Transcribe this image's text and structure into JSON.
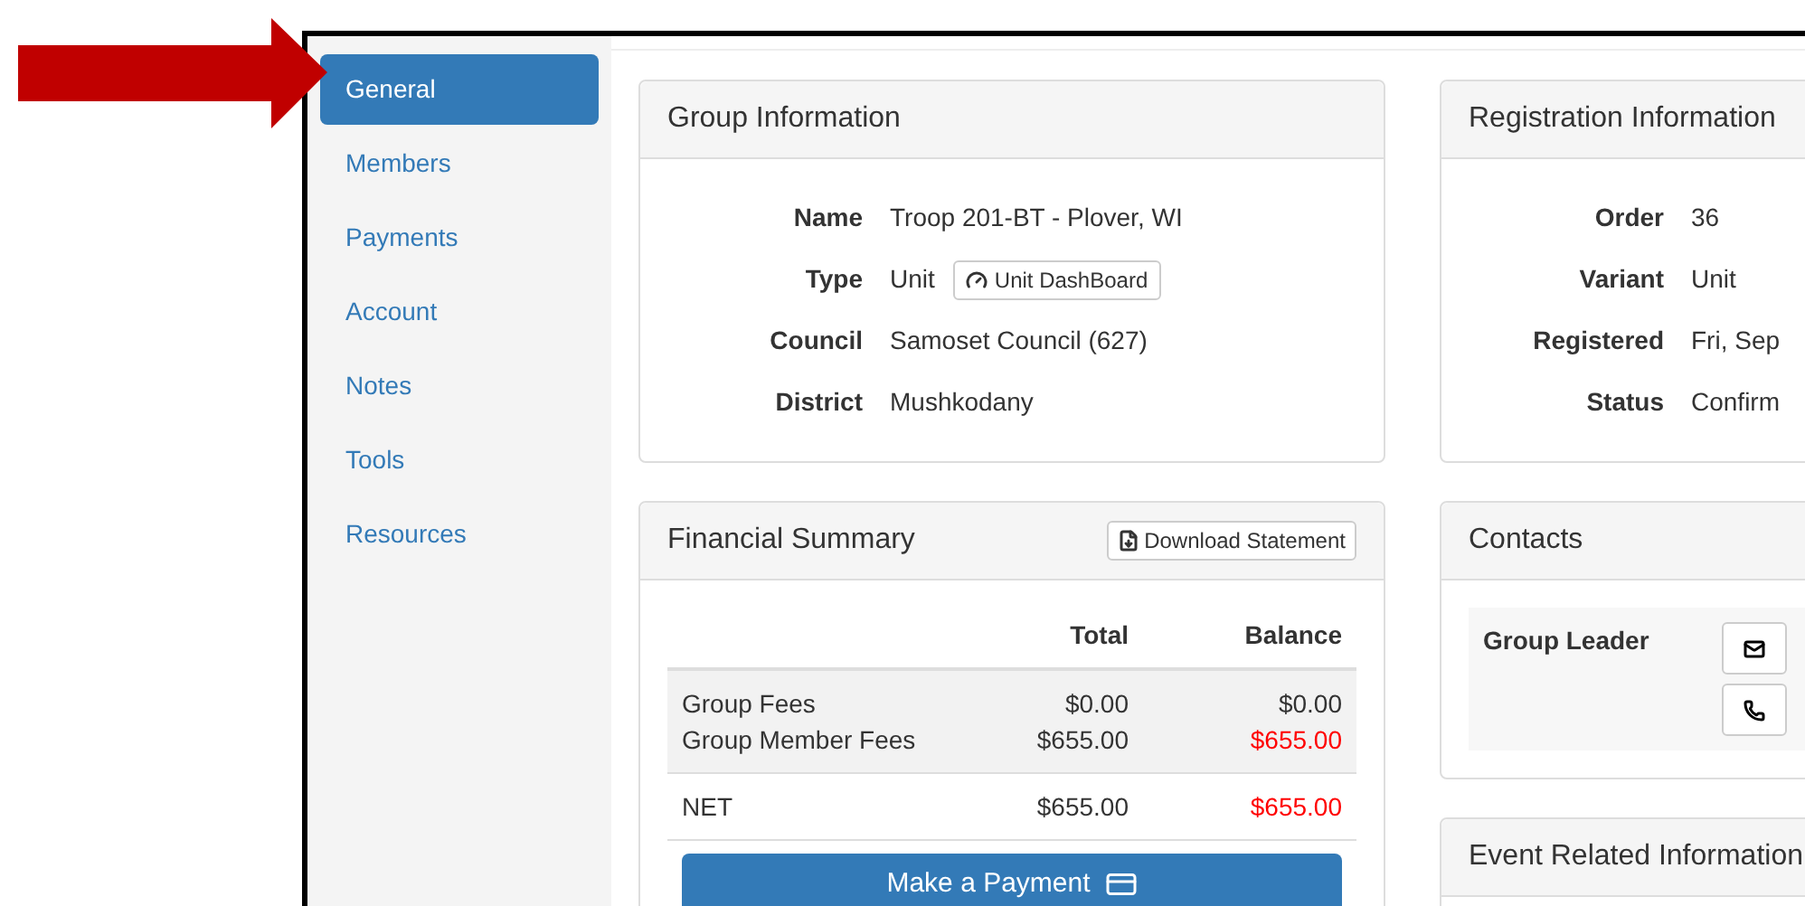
{
  "sidebar": {
    "items": [
      {
        "label": "General",
        "selected": true
      },
      {
        "label": "Members",
        "selected": false
      },
      {
        "label": "Payments",
        "selected": false
      },
      {
        "label": "Account",
        "selected": false
      },
      {
        "label": "Notes",
        "selected": false
      },
      {
        "label": "Tools",
        "selected": false
      },
      {
        "label": "Resources",
        "selected": false
      }
    ]
  },
  "group_information": {
    "title": "Group Information",
    "fields": [
      {
        "label": "Name",
        "value": "Troop 201-BT - Plover, WI"
      },
      {
        "label": "Type",
        "value": "Unit",
        "button": "Unit DashBoard"
      },
      {
        "label": "Council",
        "value": "Samoset Council (627)"
      },
      {
        "label": "District",
        "value": "Mushkodany"
      }
    ]
  },
  "financial_summary": {
    "title": "Financial Summary",
    "download_button": "Download Statement",
    "columns": [
      "Total",
      "Balance"
    ],
    "sections": [
      {
        "striped": true,
        "rows": [
          {
            "label": "Group Fees",
            "total": "$0.00",
            "balance": "$0.00",
            "owed": false
          },
          {
            "label": "Group Member Fees",
            "total": "$655.00",
            "balance": "$655.00",
            "owed": true
          }
        ]
      },
      {
        "striped": false,
        "rows": [
          {
            "label": "NET",
            "total": "$655.00",
            "balance": "$655.00",
            "owed": true
          }
        ]
      }
    ],
    "payment_button": "Make a Payment"
  },
  "registration_information": {
    "title": "Registration Information",
    "fields": [
      {
        "label": "Order",
        "value": "36"
      },
      {
        "label": "Variant",
        "value": "Unit"
      },
      {
        "label": "Registered",
        "value": "Fri, Sep"
      },
      {
        "label": "Status",
        "value": "Confirm"
      }
    ]
  },
  "contacts": {
    "title": "Contacts",
    "items": [
      {
        "role": "Group Leader"
      }
    ]
  },
  "event_related_information": {
    "title": "Event Related Information"
  }
}
